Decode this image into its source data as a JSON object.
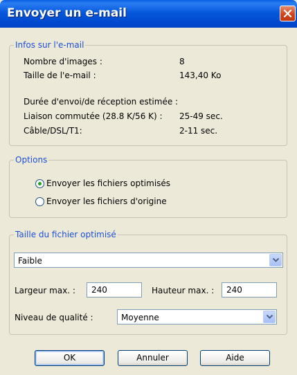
{
  "window": {
    "title": "Envoyer un e-mail"
  },
  "info": {
    "legend": "Infos sur l'e-mail",
    "images_label": "Nombre d'images :",
    "images_value": "8",
    "size_label": "Taille de l'e-mail :",
    "size_value": "143,40 Ko",
    "estimate_heading": "Durée d'envoi/de réception estimée :",
    "dialup_label": "Liaison commutée (28.8 K/56 K) :",
    "dialup_value": "25-49 sec.",
    "cable_label": "Câble/DSL/T1:",
    "cable_value": "2-11 sec."
  },
  "options": {
    "legend": "Options",
    "radio_optimized": "Envoyer les fichiers optimisés",
    "radio_original": "Envoyer les fichiers d'origine",
    "selected": "optimized"
  },
  "optimized_size": {
    "legend": "Taille du fichier optimisé",
    "preset": "Faible",
    "width_label": "Largeur max. :",
    "width_value": "240",
    "height_label": "Hauteur max. :",
    "height_value": "240",
    "quality_label": "Niveau de qualité :",
    "quality_value": "Moyenne"
  },
  "buttons": {
    "ok": "OK",
    "cancel": "Annuler",
    "help": "Aide"
  },
  "colors": {
    "titlebar": "#0054e3",
    "dialog_bg": "#ece9d8",
    "legend_text": "#1d4fd6",
    "close_button": "#d3451b"
  },
  "icons": {
    "close": "close-icon",
    "dropdown": "chevron-down-icon"
  }
}
